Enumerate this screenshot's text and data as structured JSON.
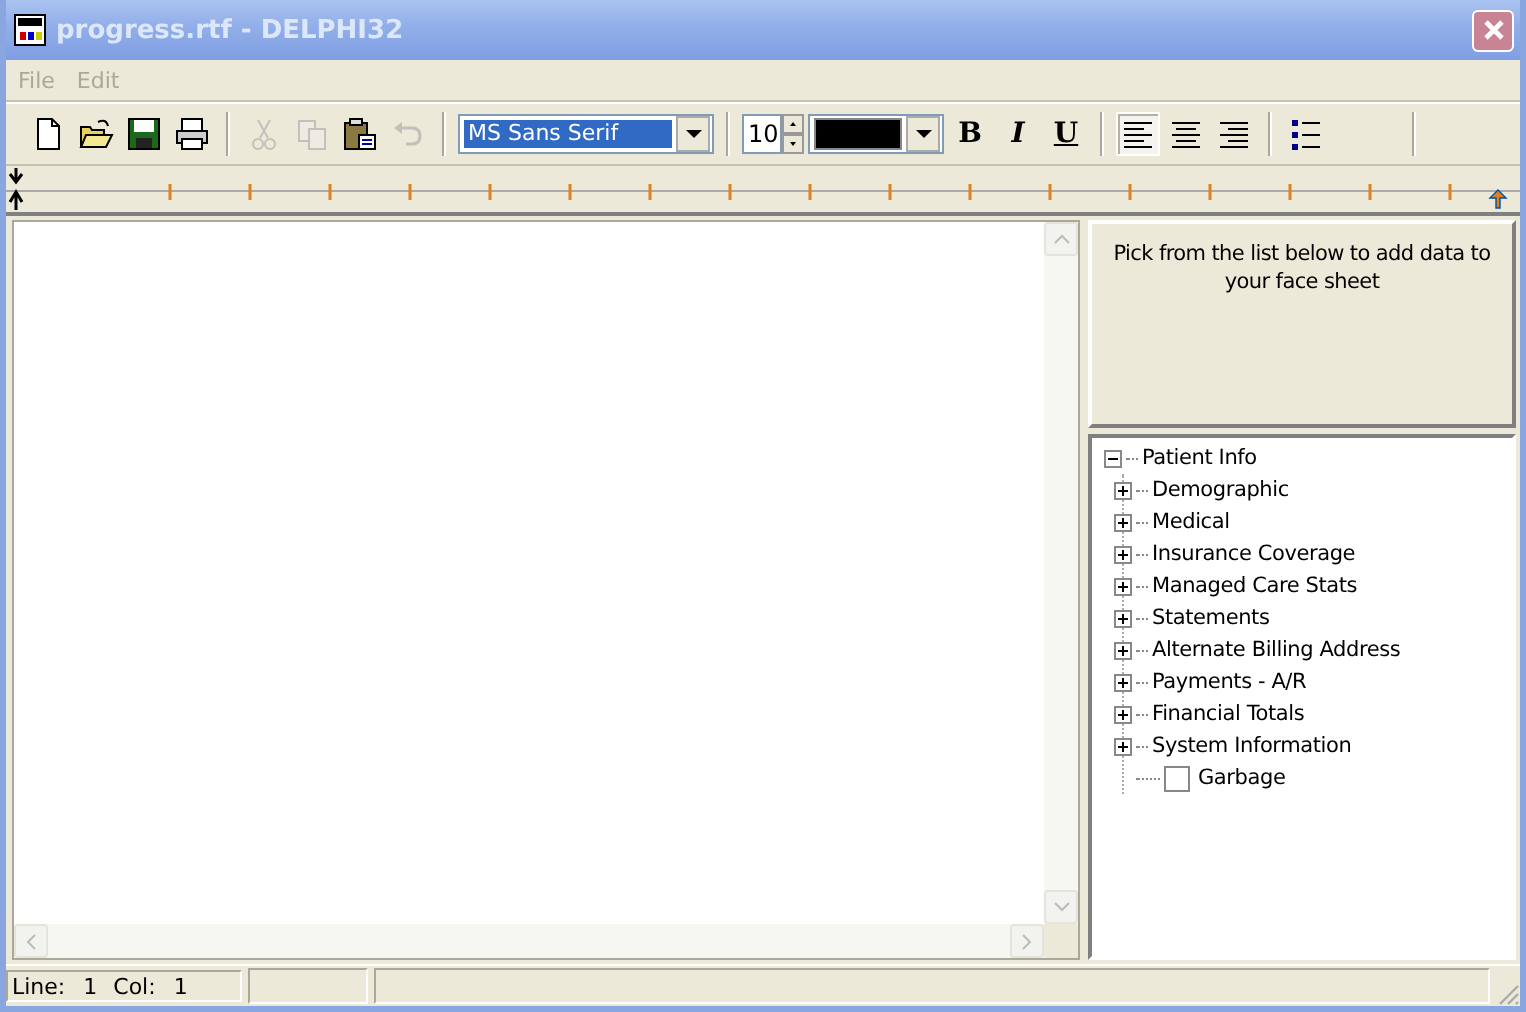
{
  "window": {
    "title": "progress.rtf - DELPHI32"
  },
  "menu": [
    {
      "label": "File",
      "disabled": true
    },
    {
      "label": "Edit",
      "disabled": true
    }
  ],
  "toolbar": {
    "buttons": [
      {
        "kind": "new",
        "disabled": false
      },
      {
        "kind": "open",
        "disabled": false
      },
      {
        "kind": "save",
        "disabled": false
      },
      {
        "kind": "print",
        "disabled": false
      },
      {
        "kind": "separator"
      },
      {
        "kind": "cut",
        "disabled": true
      },
      {
        "kind": "copy",
        "disabled": true
      },
      {
        "kind": "paste",
        "disabled": false
      },
      {
        "kind": "undo",
        "disabled": true
      },
      {
        "kind": "separator"
      },
      {
        "kind": "font",
        "value": "MS Sans Serif"
      },
      {
        "kind": "separator"
      },
      {
        "kind": "size",
        "value": "10"
      },
      {
        "kind": "color",
        "color": "#000000"
      },
      {
        "kind": "bold",
        "label": "B",
        "disabled": false
      },
      {
        "kind": "italic",
        "label": "I",
        "disabled": false
      },
      {
        "kind": "underline",
        "label": "U",
        "disabled": false
      },
      {
        "kind": "separator"
      },
      {
        "kind": "align-left",
        "selected": true
      },
      {
        "kind": "align-center",
        "selected": false
      },
      {
        "kind": "align-right",
        "selected": false
      },
      {
        "kind": "separator"
      },
      {
        "kind": "bullets",
        "selected": false
      }
    ]
  },
  "panel": {
    "message": "Pick from the list below to add data to your face sheet"
  },
  "tree": [
    {
      "label": "Patient Info",
      "expanded": true,
      "children": [
        {
          "label": "Demographic",
          "kind": "node",
          "expanded": false
        },
        {
          "label": "Medical",
          "kind": "node",
          "expanded": false
        },
        {
          "label": "Insurance Coverage",
          "kind": "node",
          "expanded": false
        },
        {
          "label": "Managed Care Stats",
          "kind": "node",
          "expanded": false
        },
        {
          "label": "Statements",
          "kind": "node",
          "expanded": false
        },
        {
          "label": "Alternate Billing Address",
          "kind": "node",
          "expanded": false
        },
        {
          "label": "Payments - A/R",
          "kind": "node",
          "expanded": false
        },
        {
          "label": "Financial Totals",
          "kind": "node",
          "expanded": false
        },
        {
          "label": "System Information",
          "kind": "node",
          "expanded": false
        },
        {
          "label": "Garbage",
          "kind": "checkbox",
          "checked": false
        }
      ]
    }
  ],
  "status_bar": {
    "line_label": "Line:",
    "line": "1",
    "col_label": "Col:",
    "col": "1"
  }
}
